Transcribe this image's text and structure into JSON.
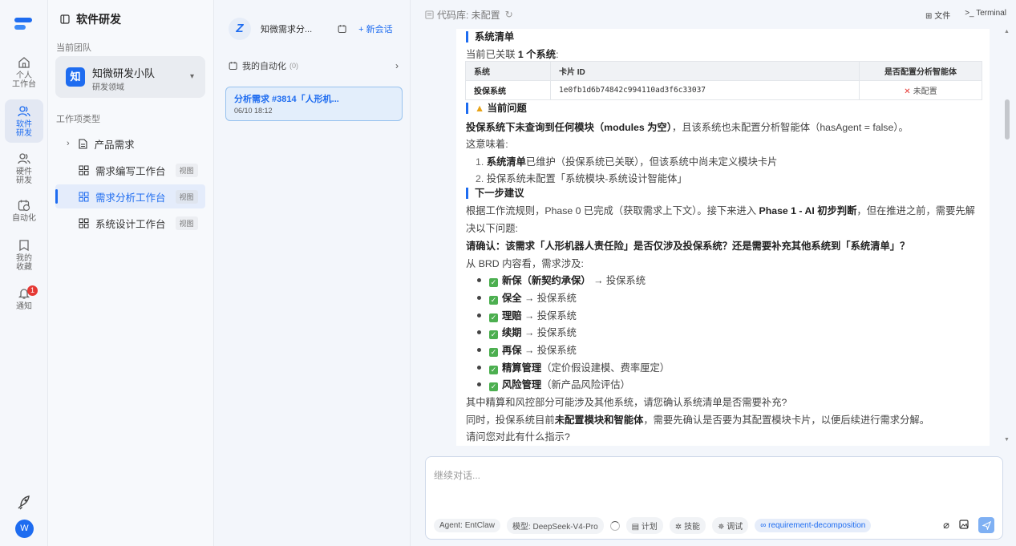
{
  "rail": {
    "items": [
      {
        "label_line1": "个人",
        "label_line2": "工作台"
      },
      {
        "label_line1": "软件",
        "label_line2": "研发"
      },
      {
        "label_line1": "硬件",
        "label_line2": "研发"
      },
      {
        "label_line1": "自动化",
        "label_line2": ""
      },
      {
        "label_line1": "我的",
        "label_line2": "收藏"
      },
      {
        "label_line1": "通知",
        "label_line2": ""
      }
    ],
    "notification_count": "1",
    "avatar": "W"
  },
  "sidebar": {
    "title": "软件研发",
    "team_label": "当前团队",
    "team": {
      "icon": "知",
      "name": "知微研发小队",
      "sub": "研发领域"
    },
    "worktype_label": "工作项类型",
    "items": [
      {
        "label": "产品需求",
        "pill": ""
      },
      {
        "label": "需求编写工作台",
        "pill": "视图"
      },
      {
        "label": "需求分析工作台",
        "pill": "视图"
      },
      {
        "label": "系统设计工作台",
        "pill": "视图"
      }
    ]
  },
  "sessions": {
    "avatar": "Z",
    "title": "知微需求分...",
    "new_label": "+ 新会话",
    "automation_label": "我的自动化",
    "automation_count": "(0)",
    "card": {
      "title": "分析需求 #3814「人形机...",
      "date": "06/10 18:12"
    }
  },
  "topbar": {
    "repo": "代码库: 未配置",
    "files": "文件",
    "terminal": "Terminal"
  },
  "doc": {
    "sec_systems": "系统清单",
    "linked_pre": "当前已关联 ",
    "linked_bold": "1 个系统",
    "linked_post": ":",
    "table": {
      "headers": [
        "系统",
        "卡片 ID",
        "是否配置分析智能体"
      ],
      "row": {
        "system": "投保系统",
        "card_id": "1e0fb1d6b74842c994110ad3f6c33037",
        "status": "未配置"
      }
    },
    "sec_problem": "当前问题",
    "problem_bold": "投保系统下未查询到任何模块（modules 为空）",
    "problem_rest": "，且该系统也未配置分析智能体（hasAgent = false）。",
    "means": "这意味着:",
    "n1_bold": "系统清单",
    "n1_rest": "已维护（投保系统已关联），但该系统中尚未定义模块卡片",
    "n2": "投保系统未配置「系统模块-系统设计智能体」",
    "sec_next": "下一步建议",
    "next_1a": "根据工作流规则，Phase 0 已完成（获取需求上下文）。接下来进入 ",
    "next_1b": "Phase 1 - AI 初步判断",
    "next_1c": "，但在推进之前，需要先解",
    "next_2": "决以下问题:",
    "confirm": "请确认：该需求「人形机器人责任险」是否仅涉及投保系统？还是需要补充其他系统到「系统清单」？",
    "brd": "从 BRD 内容看，需求涉及:",
    "bullets": [
      {
        "bold": "新保（新契约承保）",
        "rest": " → 投保系统"
      },
      {
        "bold": "保全",
        "rest": " → 投保系统"
      },
      {
        "bold": "理赔",
        "rest": " → 投保系统"
      },
      {
        "bold": "续期",
        "rest": " → 投保系统"
      },
      {
        "bold": "再保",
        "rest": " → 投保系统"
      },
      {
        "bold": "精算管理",
        "rest": "（定价假设建模、费率厘定）"
      },
      {
        "bold": "风险管理",
        "rest": "（新产品风险评估）"
      }
    ],
    "q1": "其中精算和风控部分可能涉及其他系统，请您确认系统清单是否需要补充?",
    "q2a": "同时，投保系统目前",
    "q2b": "未配置模块和智能体",
    "q2c": "，需要先确认是否要为其配置模块卡片，以便后续进行需求分解。",
    "q3": "请问您对此有什么指示?"
  },
  "composer": {
    "placeholder": "继续对话...",
    "agent": "Agent: EntClaw",
    "model": "模型: DeepSeek-V4-Pro",
    "plan": "计划",
    "skill": "技能",
    "debug": "调试",
    "skill_tag": "requirement-decomposition"
  }
}
